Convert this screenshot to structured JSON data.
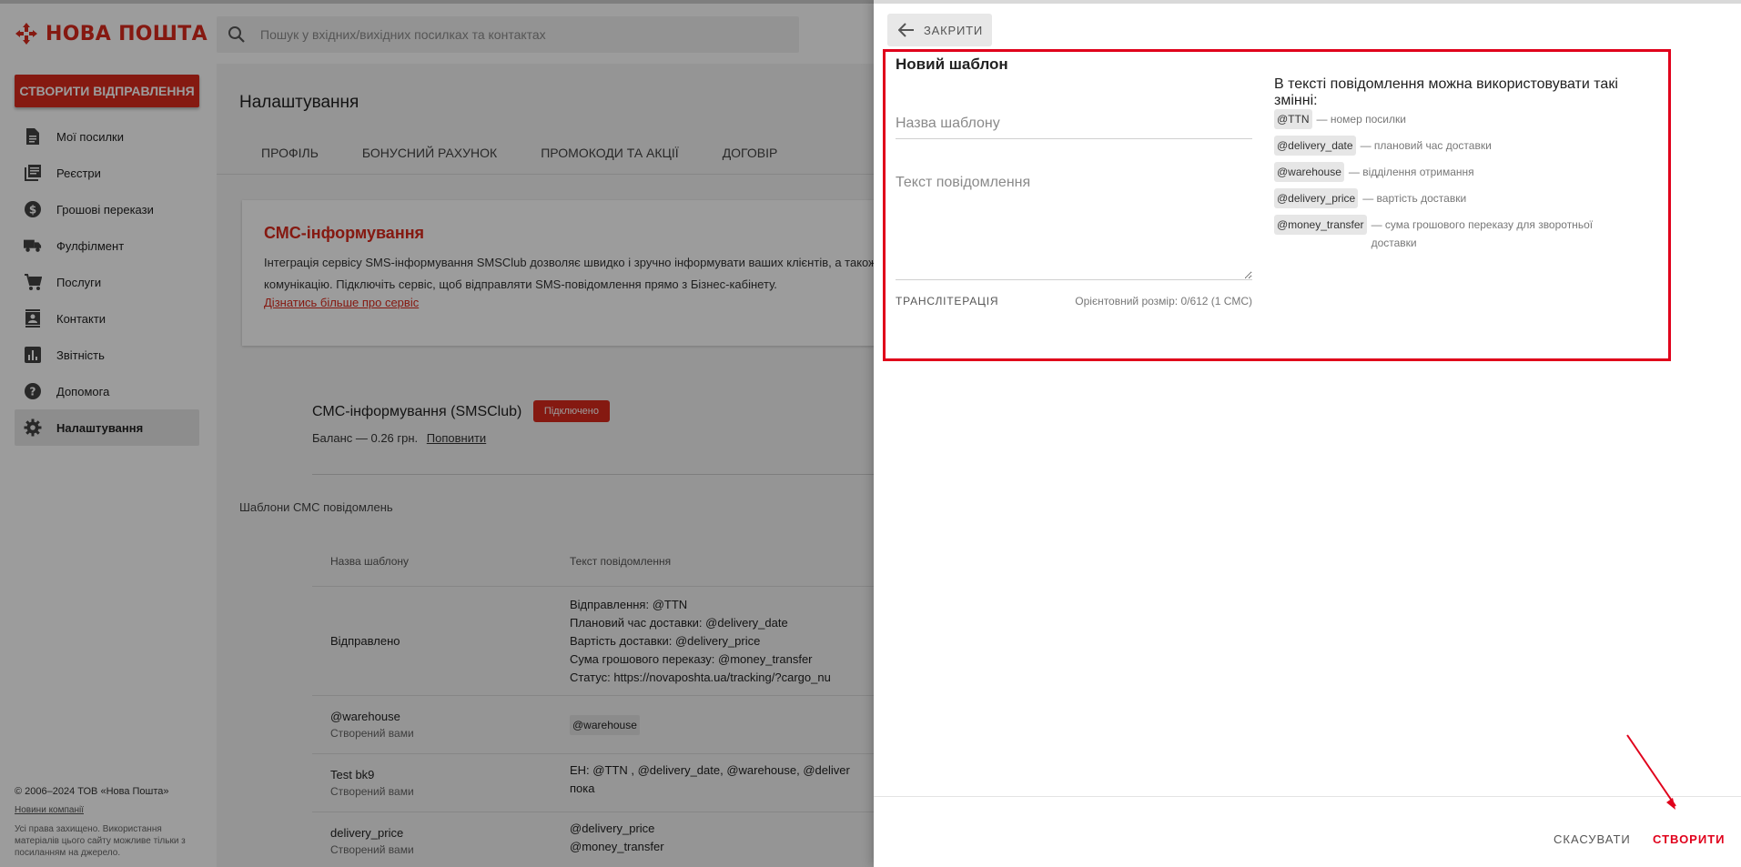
{
  "brand": {
    "name": "НОВА ПОШТА",
    "accent": "#da291c"
  },
  "search": {
    "placeholder": "Пошук у вхідних/вихідних посилках та контактах"
  },
  "sidebar": {
    "create_label": "СТВОРИТИ ВІДПРАВЛЕННЯ",
    "items": [
      {
        "label": "Мої посилки",
        "icon": "document-icon"
      },
      {
        "label": "Реєстри",
        "icon": "registry-icon"
      },
      {
        "label": "Грошові перекази",
        "icon": "money-icon"
      },
      {
        "label": "Фулфілмент",
        "icon": "truck-icon"
      },
      {
        "label": "Послуги",
        "icon": "cart-icon"
      },
      {
        "label": "Контакти",
        "icon": "contacts-icon"
      },
      {
        "label": "Звітність",
        "icon": "chart-icon"
      },
      {
        "label": "Допомога",
        "icon": "help-icon"
      },
      {
        "label": "Налаштування",
        "icon": "gear-icon"
      }
    ],
    "copyright": "© 2006–2024 ТОВ «Нова Пошта»",
    "news_link": "Новини компанії",
    "note": "Усі права захищено. Використання матеріалів цього сайту можливе тільки з посиланням на джерело."
  },
  "main": {
    "title": "Налаштування",
    "tabs": [
      "ПРОФІЛЬ",
      "БОНУСНИЙ РАХУНОК",
      "ПРОМОКОДИ ТА АКЦІЇ",
      "ДОГОВІР"
    ],
    "sms_card": {
      "title": "СМС-інформування",
      "text": "Інтеграція сервісу SMS-інформування SMSClub дозволяє швидко і зручно інформувати ваших клієнтів, а також комунікацію. Підключіть сервіс, щоб відправляти SMS-повідомлення прямо з Бізнес-кабінету.",
      "link": "Дізнатись більше про сервіс"
    },
    "sms_service": {
      "name": "СМС-інформування (SMSClub)",
      "badge": "Підключено",
      "balance": "Баланс — 0.26 грн.",
      "topup": "Поповнити"
    },
    "templates_title": "Шаблони СМС повідомлень",
    "table": {
      "headers": [
        "Назва шаблону",
        "Текст повідомлення"
      ],
      "rows": [
        {
          "name": "Відправлено",
          "sub": "",
          "text": [
            "Відправлення: @TTN",
            "Плановий час доставки: @delivery_date",
            "Вартість доставки: @delivery_price",
            "Сума грошового переказу: @money_transfer",
            "Статус: https://novaposhta.ua/tracking/?cargo_nu"
          ]
        },
        {
          "name": "@warehouse",
          "sub": "Створений вами",
          "text": [
            "@warehouse"
          ]
        },
        {
          "name": "Test bk9",
          "sub": "Створений вами",
          "text": [
            "ЕН: @TTN , @delivery_date, @warehouse, @deliver",
            "пока"
          ]
        },
        {
          "name": "delivery_price",
          "sub": "Створений вами",
          "text": [
            "@delivery_price",
            "@money_transfer"
          ]
        }
      ]
    }
  },
  "drawer": {
    "close_label": "ЗАКРИТИ",
    "form_title": "Новий шаблон",
    "name_placeholder": "Назва шаблону",
    "message_placeholder": "Текст повідомлення",
    "translit_label": "ТРАНСЛІТЕРАЦІЯ",
    "size_info": "Орієнтовний розмір: 0/612 (1 СМС)",
    "vars_title": "В тексті повідомлення можна використовувати такі змінні:",
    "variables": [
      {
        "name": "@TTN",
        "desc": "— номер посилки"
      },
      {
        "name": "@delivery_date",
        "desc": "— плановий час доставки"
      },
      {
        "name": "@warehouse",
        "desc": "— відділення отримання"
      },
      {
        "name": "@delivery_price",
        "desc": "— вартість доставки"
      },
      {
        "name": "@money_transfer",
        "desc": "— сума грошового переказу для зворотньої доставки"
      }
    ],
    "cancel_label": "СКАСУВАТИ",
    "submit_label": "СТВОРИТИ",
    "highlight_color": "#e0001b"
  }
}
